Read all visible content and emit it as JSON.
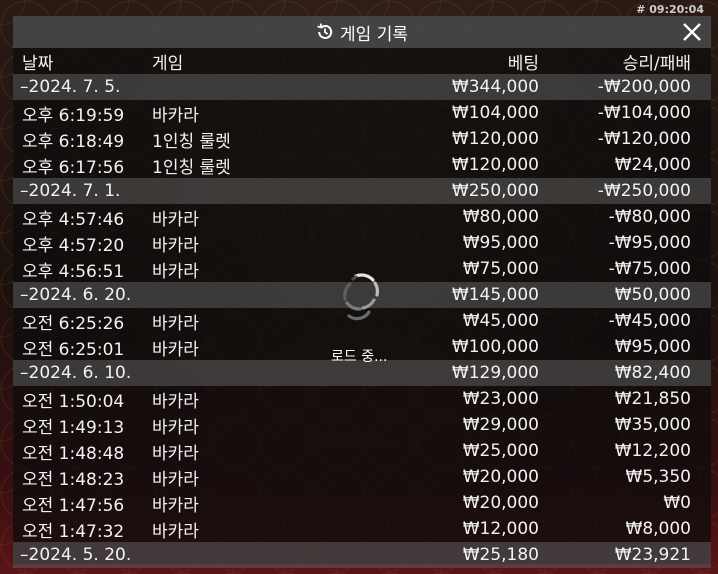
{
  "timestamp": "# 09:20:04",
  "dialog": {
    "title": "게임 기록",
    "icons": {
      "history": "history-clock-icon",
      "close": "close-icon"
    }
  },
  "columns": {
    "date": "날짜",
    "game": "게임",
    "bet": "베팅",
    "win_loss": "승리/패배"
  },
  "loading": {
    "text": "로드 중..."
  },
  "groups": [
    {
      "date": "–2024. 7. 5.",
      "bet": "₩344,000",
      "win_loss": "-₩200,000",
      "rows": [
        {
          "time": "오후 6:19:59",
          "game": "바카라",
          "bet": "₩104,000",
          "win_loss": "-₩104,000"
        },
        {
          "time": "오후 6:18:49",
          "game": "1인칭 룰렛",
          "bet": "₩120,000",
          "win_loss": "-₩120,000"
        },
        {
          "time": "오후 6:17:56",
          "game": "1인칭 룰렛",
          "bet": "₩120,000",
          "win_loss": "₩24,000"
        }
      ]
    },
    {
      "date": "–2024. 7. 1.",
      "bet": "₩250,000",
      "win_loss": "-₩250,000",
      "rows": [
        {
          "time": "오후 4:57:46",
          "game": "바카라",
          "bet": "₩80,000",
          "win_loss": "-₩80,000"
        },
        {
          "time": "오후 4:57:20",
          "game": "바카라",
          "bet": "₩95,000",
          "win_loss": "-₩95,000"
        },
        {
          "time": "오후 4:56:51",
          "game": "바카라",
          "bet": "₩75,000",
          "win_loss": "-₩75,000"
        }
      ]
    },
    {
      "date": "–2024. 6. 20.",
      "bet": "₩145,000",
      "win_loss": "₩50,000",
      "rows": [
        {
          "time": "오전 6:25:26",
          "game": "바카라",
          "bet": "₩45,000",
          "win_loss": "-₩45,000"
        },
        {
          "time": "오전 6:25:01",
          "game": "바카라",
          "bet": "₩100,000",
          "win_loss": "₩95,000"
        }
      ]
    },
    {
      "date": "–2024. 6. 10.",
      "bet": "₩129,000",
      "win_loss": "₩82,400",
      "rows": [
        {
          "time": "오전 1:50:04",
          "game": "바카라",
          "bet": "₩23,000",
          "win_loss": "₩21,850"
        },
        {
          "time": "오전 1:49:13",
          "game": "바카라",
          "bet": "₩29,000",
          "win_loss": "₩35,000"
        },
        {
          "time": "오전 1:48:48",
          "game": "바카라",
          "bet": "₩25,000",
          "win_loss": "₩12,200"
        },
        {
          "time": "오전 1:48:23",
          "game": "바카라",
          "bet": "₩20,000",
          "win_loss": "₩5,350"
        },
        {
          "time": "오전 1:47:56",
          "game": "바카라",
          "bet": "₩20,000",
          "win_loss": "₩0"
        },
        {
          "time": "오전 1:47:32",
          "game": "바카라",
          "bet": "₩12,000",
          "win_loss": "₩8,000"
        }
      ]
    },
    {
      "date": "–2024. 5. 20.",
      "bet": "₩25,180",
      "win_loss": "₩23,921",
      "rows": []
    }
  ]
}
